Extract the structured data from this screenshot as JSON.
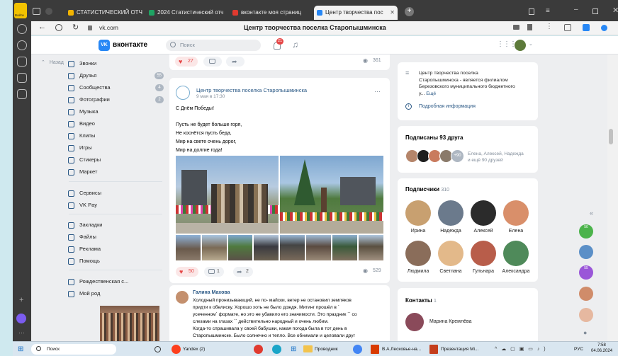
{
  "browser": {
    "profile_label": "Войти",
    "tabs": [
      {
        "label": "СТАТИСТИЧЕСКИЙ ОТЧ",
        "color": "#f2b400"
      },
      {
        "label": "2024 Статистический отч",
        "color": "#1fa463"
      },
      {
        "label": "вконтакте моя страниц",
        "color": "#e03a2f"
      },
      {
        "label": "Центр творчества пос",
        "color": "#2787f5"
      }
    ],
    "url": "vk.com",
    "page_title": "Центр творчества поселка Старопышминска"
  },
  "vk": {
    "logo": "вконтакте",
    "search_placeholder": "Поиск",
    "notifications_count": "21"
  },
  "sidebar": {
    "back_label": "Назад",
    "items": [
      {
        "label": "Звонки",
        "badge": ""
      },
      {
        "label": "Друзья",
        "badge": "55"
      },
      {
        "label": "Сообщества",
        "badge": "4"
      },
      {
        "label": "Фотографии",
        "badge": "2"
      },
      {
        "label": "Музыка",
        "badge": ""
      },
      {
        "label": "Видео",
        "badge": ""
      },
      {
        "label": "Клипы",
        "badge": ""
      },
      {
        "label": "Игры",
        "badge": ""
      },
      {
        "label": "Стикеры",
        "badge": ""
      },
      {
        "label": "Маркет",
        "badge": ""
      }
    ],
    "items2": [
      {
        "label": "Сервисы"
      },
      {
        "label": "VK Pay"
      }
    ],
    "items3": [
      {
        "label": "Закладки"
      },
      {
        "label": "Файлы"
      },
      {
        "label": "Реклама"
      },
      {
        "label": "Помощь"
      }
    ],
    "items4": [
      {
        "label": "Рождественская с..."
      },
      {
        "label": "Мой род"
      }
    ]
  },
  "prev_post": {
    "likes": "27",
    "views": "361"
  },
  "post": {
    "author": "Центр творчества поселка Старопышминска",
    "date": "9 мая в 17:30",
    "greeting": "С Днём Победы!",
    "poem": [
      "Пусть не будет больше горя,",
      "Не коснётся пусть беда,",
      "Мир на свете очень дорог,",
      "Мир на долгие года!"
    ],
    "likes": "50",
    "comments": "1",
    "shares": "2",
    "views": "529"
  },
  "comment": {
    "author": "Галина Махова",
    "lines": [
      "Холодный пронизывающий, не по- майски, ветер не остановил земляков",
      "придти к обелиску. Хорошо хоть не было дождя. Митинг прошёл в `",
      "усеченном` формате, но это не убавило его значимости. Это праздник `` со",
      "слезами на глазах `` действительно народный и очень любим.",
      "Когда-то спрашивала у своей бабушки, какая погода была в тот день в",
      "Старопышминске. Было солнечно и тепло. Все обнимали и целовали друг"
    ]
  },
  "about": {
    "text": [
      "Центр творчества поселка",
      "Старопышминска - является филиалом",
      "Березовского муниципального бюджетного",
      "у..."
    ],
    "more": "Ещё",
    "info_link": "Подробная информация"
  },
  "friends_card": {
    "title": "Подписаны 93 друга",
    "more_count": "+90",
    "names_line1": "Елена, Алексей, Надежда",
    "names_line2": "и ещё 90 друзей"
  },
  "subscribers": {
    "title": "Подписчики",
    "count": "310",
    "people": [
      {
        "name": "Ирина",
        "color": "#c8a070"
      },
      {
        "name": "Надежда",
        "color": "#6b7a8c"
      },
      {
        "name": "Алексей",
        "color": "#2b2b2b"
      },
      {
        "name": "Елена",
        "color": "#d98f6a"
      },
      {
        "name": "Людмила",
        "color": "#8a6d5a"
      },
      {
        "name": "Светлана",
        "color": "#e3b98a"
      },
      {
        "name": "Гульнара",
        "color": "#b85d4a"
      },
      {
        "name": "Александра",
        "color": "#4f8a5a"
      }
    ]
  },
  "contacts": {
    "title": "Контакты",
    "count": "1",
    "person": "Марина Кремлёва"
  },
  "taskbar": {
    "search": "Поиск",
    "items": [
      "Yandex (2)",
      "Проводник",
      "В.А.Лесковье-на...",
      "Презентация Mi..."
    ],
    "lang": "РУС",
    "time": "7:58",
    "date": "04.06.2024"
  },
  "colors": {
    "vk_blue": "#2787f5",
    "like_red": "#e64646",
    "link": "#2a5885"
  }
}
